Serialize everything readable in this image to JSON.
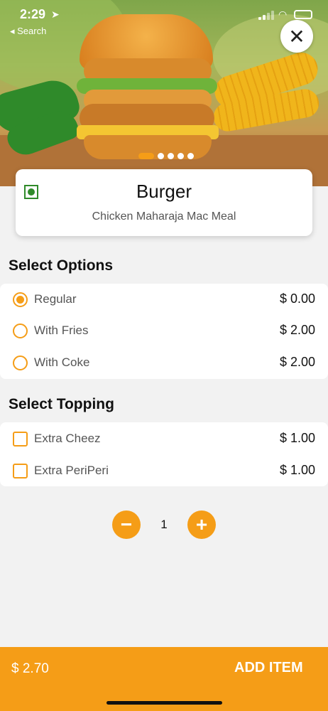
{
  "status_bar": {
    "time": "2:29",
    "back_label": "◂ Search"
  },
  "hero": {
    "dots": 5,
    "active_dot": 0
  },
  "item": {
    "title": "Burger",
    "subtitle": "Chicken Maharaja Mac Meal"
  },
  "options_section": {
    "heading": "Select Options",
    "items": [
      {
        "label": "Regular",
        "price": "$ 0.00",
        "selected": true
      },
      {
        "label": "With Fries",
        "price": "$ 2.00",
        "selected": false
      },
      {
        "label": "With Coke",
        "price": "$ 2.00",
        "selected": false
      }
    ]
  },
  "topping_section": {
    "heading": "Select Topping",
    "items": [
      {
        "label": "Extra Cheez",
        "price": "$ 1.00",
        "checked": false
      },
      {
        "label": "Extra PeriPeri",
        "price": "$ 1.00",
        "checked": false
      }
    ]
  },
  "stepper": {
    "minus": "−",
    "plus": "+",
    "quantity": "1"
  },
  "footer": {
    "total": "$ 2.70",
    "add_label": "ADD ITEM"
  },
  "colors": {
    "accent": "#f59d17",
    "veg": "#2f8a2a"
  }
}
